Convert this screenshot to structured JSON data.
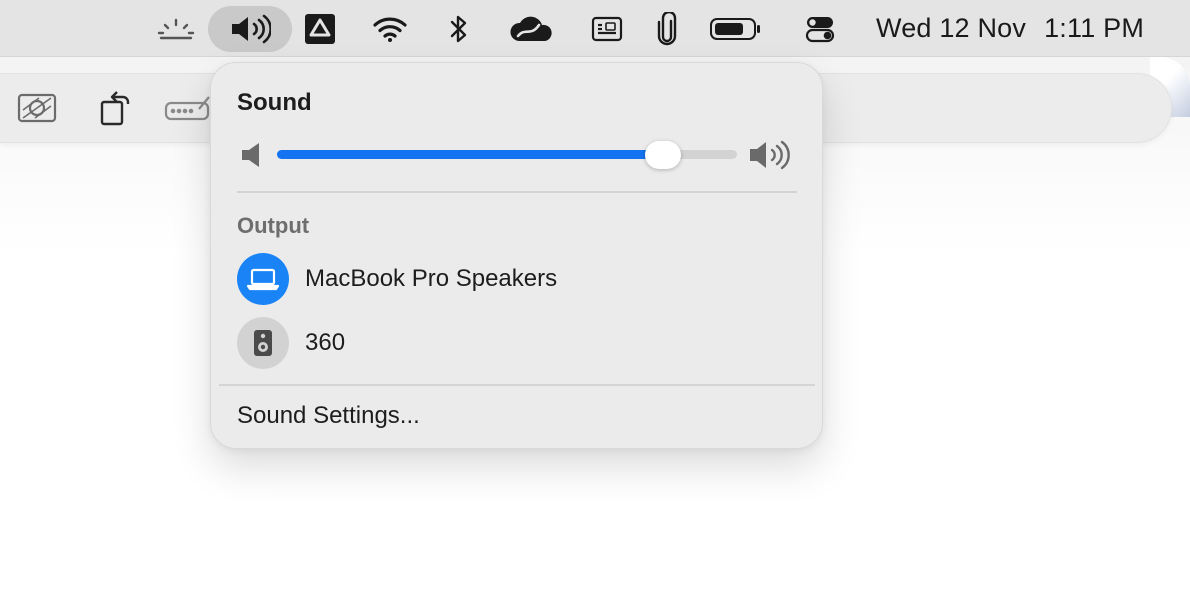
{
  "menubar": {
    "items": [
      {
        "icon": "brightness-icon"
      },
      {
        "icon": "speaker-icon",
        "active": true
      },
      {
        "icon": "google-drive-icon"
      },
      {
        "icon": "wifi-icon"
      },
      {
        "icon": "bluetooth-icon"
      },
      {
        "icon": "cloud-sync-icon"
      },
      {
        "icon": "keyboard-icon"
      },
      {
        "icon": "paperclip-icon"
      },
      {
        "icon": "battery-icon"
      },
      {
        "icon": "control-center-icon"
      }
    ],
    "date": "Wed 12 Nov",
    "time": "1:11 PM"
  },
  "toolbar": {
    "items": [
      {
        "icon": "photo-frame-icon"
      },
      {
        "icon": "rotate-icon"
      },
      {
        "icon": "signature-icon"
      }
    ]
  },
  "sound_menu": {
    "title": "Sound",
    "volume": 0.84,
    "output_label": "Output",
    "devices": [
      {
        "name": "MacBook Pro Speakers",
        "icon": "laptop-icon",
        "selected": true
      },
      {
        "name": "360",
        "icon": "speaker-device-icon",
        "selected": false
      }
    ],
    "settings_label": "Sound Settings..."
  },
  "colors": {
    "accent": "#1373f0",
    "selected_device": "#1a84f7",
    "menubar_bg": "#e4e4e4",
    "popover_bg": "#ebebeb"
  }
}
